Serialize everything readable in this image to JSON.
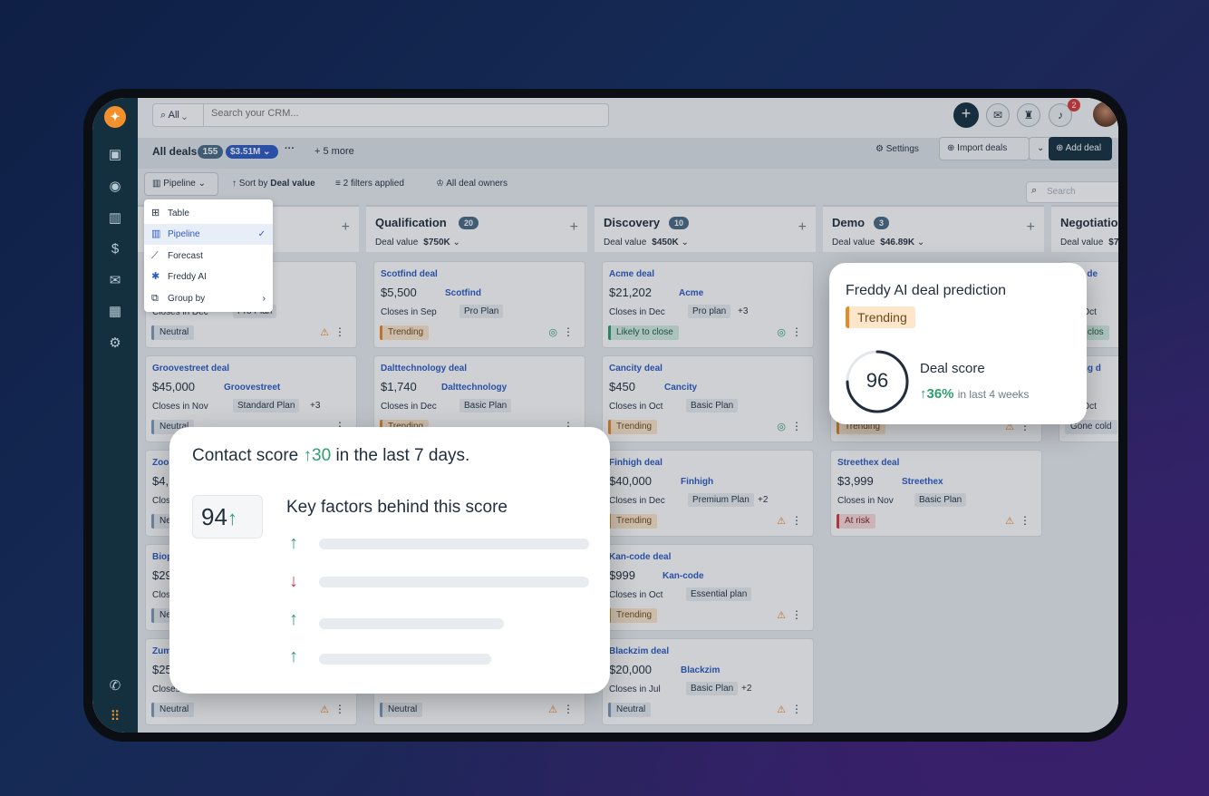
{
  "topbar": {
    "scope": "All",
    "search_placeholder": "Search your CRM...",
    "notifications_count": "2"
  },
  "viewbar": {
    "title": "All deals",
    "count": "155",
    "total": "$3.51M",
    "more": "5 more",
    "settings": "Settings",
    "import": "Import deals",
    "add": "Add deal"
  },
  "filterbar": {
    "view": "Pipeline",
    "sort_prefix": "Sort by",
    "sort_field": "Deal value",
    "filters": "2 filters applied",
    "owners": "All deal owners",
    "search_placeholder": "Search"
  },
  "dropdown": {
    "items": [
      {
        "label": "Table"
      },
      {
        "label": "Pipeline"
      },
      {
        "label": "Forecast"
      },
      {
        "label": "Freddy AI"
      },
      {
        "label": "Group by"
      }
    ]
  },
  "columns": [
    {
      "title": "",
      "count": "",
      "value_label": "",
      "value": ""
    },
    {
      "title": "Qualification",
      "count": "20",
      "value_label": "Deal value",
      "value": "$750K"
    },
    {
      "title": "Discovery",
      "count": "10",
      "value_label": "Deal value",
      "value": "$450K"
    },
    {
      "title": "Demo",
      "count": "3",
      "value_label": "Deal value",
      "value": "$46.89K"
    },
    {
      "title": "Negotiatio",
      "count": "",
      "value_label": "Deal value",
      "value": "$7"
    }
  ],
  "cards": {
    "c0_0": {
      "close": "Closes in Dec",
      "plan": "Pro Plan",
      "tag": "Neutral"
    },
    "c0_1": {
      "name": "Groovestreet deal",
      "amount": "$45,000",
      "company": "Groovestreet",
      "close": "Closes in Nov",
      "plan": "Standard Plan",
      "extra": "+3",
      "tag": "Neutral"
    },
    "c0_2": {
      "name": "Zoon",
      "amount": "$4,",
      "close": "Closi",
      "tag": "Neu"
    },
    "c0_3": {
      "name": "Biop",
      "amount": "$29",
      "close": "Closi",
      "tag": "Neu"
    },
    "c0_4": {
      "name": "Zum",
      "amount": "$25",
      "close": "Closes i",
      "tag": "Neutral"
    },
    "c1_0": {
      "name": "Scotfind deal",
      "amount": "$5,500",
      "company": "Scotfind",
      "close": "Closes in Sep",
      "plan": "Pro Plan",
      "tag": "Trending"
    },
    "c1_1": {
      "name": "Dalttechnology deal",
      "amount": "$1,740",
      "company": "Dalttechnology",
      "close": "Closes in Dec",
      "plan": "Basic Plan",
      "tag": "Trending"
    },
    "c1_4": {
      "tag": "Neutral"
    },
    "c2_0": {
      "name": "Acme deal",
      "amount": "$21,202",
      "company": "Acme",
      "close": "Closes in Dec",
      "plan": "Pro plan",
      "extra": "+3",
      "tag": "Likely to close"
    },
    "c2_1": {
      "name": "Cancity deal",
      "amount": "$450",
      "company": "Cancity",
      "close": "Closes in Oct",
      "plan": "Basic Plan",
      "tag": "Trending"
    },
    "c2_2": {
      "name": "Finhigh deal",
      "amount": "$40,000",
      "company": "Finhigh",
      "close": "Closes in Dec",
      "plan": "Premium Plan",
      "extra": "+2",
      "tag": "Trending"
    },
    "c2_3": {
      "name": "Kan-code deal",
      "amount": "$999",
      "company": "Kan-code",
      "close": "Closes in Oct",
      "plan": "Essential plan",
      "tag": "Trending"
    },
    "c2_4": {
      "name": "Blackzim deal",
      "amount": "$20,000",
      "company": "Blackzim",
      "close": "Closes in Jul",
      "plan": "Basic Plan",
      "extra": "+2",
      "tag": "Neutral"
    },
    "c3_1": {
      "tag": "Trending"
    },
    "c3_2": {
      "name": "Streethex deal",
      "amount": "$3,999",
      "company": "Streethex",
      "close": "Closes in Nov",
      "plan": "Basic Plan",
      "tag": "At risk"
    },
    "c4_0": {
      "name": "atfix de",
      "amount": "000",
      "close": "s in Oct",
      "tag": "y to clos"
    },
    "c4_1": {
      "name": "olding d",
      "amount": "000",
      "close": "s in Oct",
      "tag": "Gone cold"
    }
  },
  "contact_popup": {
    "title_prefix": "Contact score",
    "delta": "30",
    "title_suffix": "in the last 7 days.",
    "score": "94",
    "factors_title": "Key factors behind this score"
  },
  "freddy_popup": {
    "title": "Freddy AI deal prediction",
    "tag": "Trending",
    "score": "96",
    "score_label": "Deal score",
    "delta": "36%",
    "period": "in last 4 weeks"
  },
  "colors": {
    "rail": "#14303f",
    "accent_blue": "#2c5cc5",
    "up_green": "#2f9e6e",
    "down_red": "#d83a3a",
    "trending_orange": "#e8892b"
  }
}
